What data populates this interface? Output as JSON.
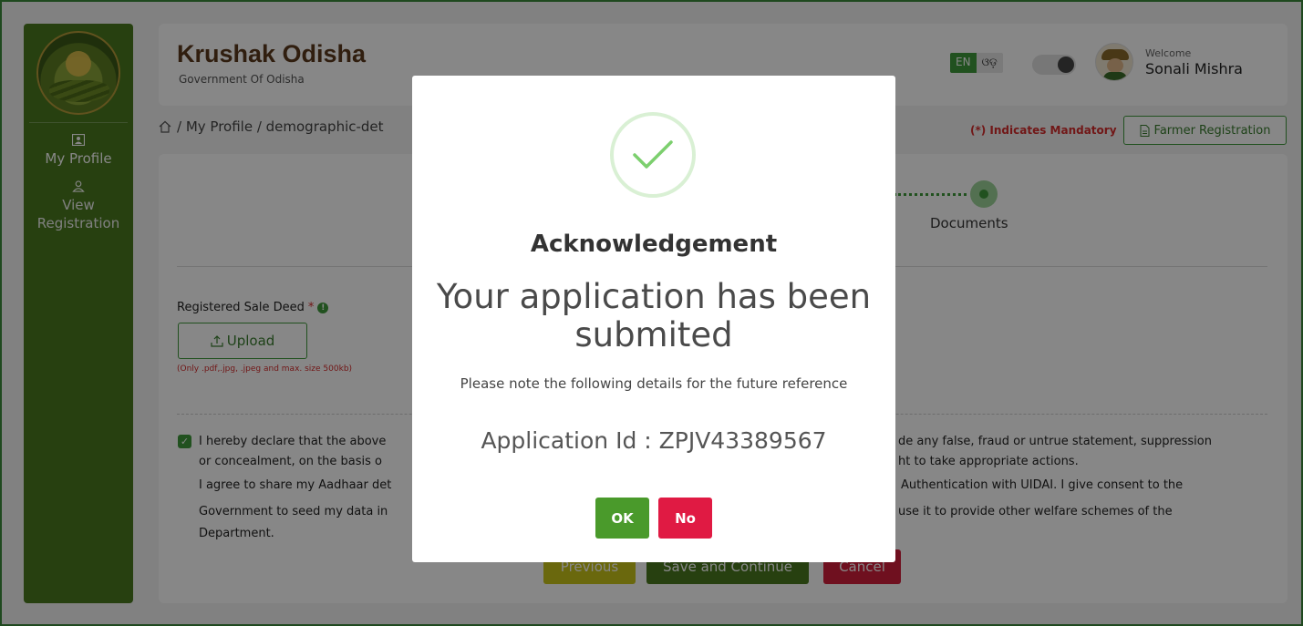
{
  "app": {
    "title": "Krushak Odisha",
    "subtitle": "Government Of Odisha"
  },
  "header": {
    "lang_en": "EN",
    "lang_or": "ଓଡ଼",
    "welcome": "Welcome",
    "username": "Sonali Mishra"
  },
  "sidebar": {
    "items": [
      {
        "label": "My Profile",
        "icon": "profile-card-icon"
      },
      {
        "label": "View Registration",
        "icon": "user-icon"
      }
    ]
  },
  "breadcrumb": {
    "text": "/ My Profile / demographic-det"
  },
  "mandatory_note": "(*) Indicates Mandatory",
  "farmer_registration_label": "Farmer Registration",
  "stepper": {
    "current_label": "Documents"
  },
  "form": {
    "sale_deed_label": "Registered Sale Deed",
    "required_marker": "*",
    "info_marker": "!",
    "upload_label": "Upload",
    "upload_note": "(Only .pdf,.jpg, .jpeg and max. size 500kb)",
    "declaration": {
      "line1_left": "I hereby declare that the above",
      "line1_right": "de any false, fraud or untrue statement, suppression",
      "line2_left": "or concealment, on the basis o",
      "line2_right": "ht to take appropriate actions.",
      "line3_left": "I agree to share my Aadhaar det",
      "line3_right": "Authentication with UIDAI. I give consent to the",
      "line4_left": "Government to seed my data in",
      "line4_right": "use it to provide other welfare schemes of the",
      "line5_left": "Department."
    },
    "buttons": {
      "previous": "Previous",
      "save": "Save and Continue",
      "cancel": "Cancel"
    }
  },
  "modal": {
    "title": "Acknowledgement",
    "message": "Your application has been submited",
    "note": "Please note the following details for the future reference",
    "application_id": "Application Id : ZPJV43389567",
    "ok_label": "OK",
    "no_label": "No"
  },
  "colors": {
    "brand_green": "#4a7a1f",
    "accent_green": "#3f9a3b",
    "danger_red": "#e01a43",
    "title_brown": "#5b3a1e"
  }
}
